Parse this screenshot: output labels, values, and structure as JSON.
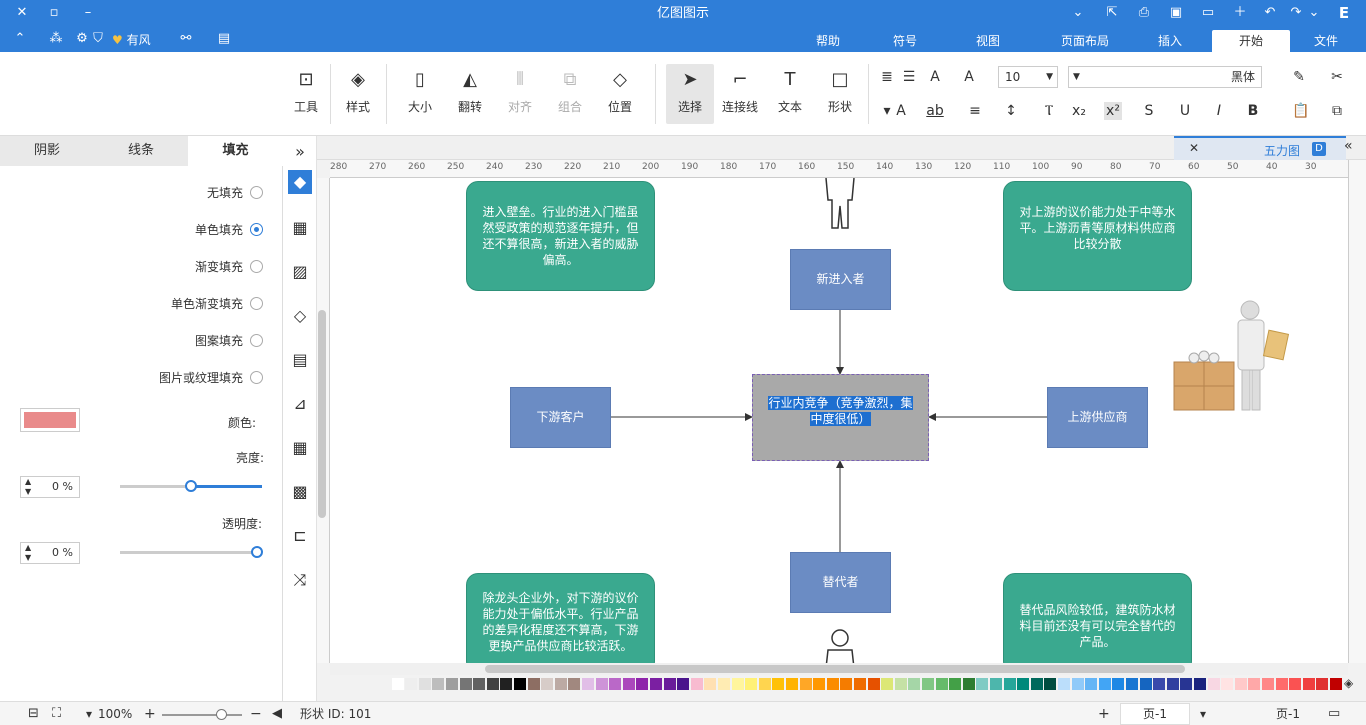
{
  "app": {
    "title": "亿图图示"
  },
  "menu": {
    "tabs": [
      "文件",
      "开始",
      "插入",
      "页面布局",
      "视图",
      "符号",
      "帮助"
    ],
    "active": "开始",
    "right_items": {
      "theme": "有风"
    }
  },
  "ribbon": {
    "font_name": "黑体",
    "font_size": "10",
    "buttons": {
      "shape": "形状",
      "text": "文本",
      "connector": "连接线",
      "select": "选择",
      "position": "位置",
      "group": "组合",
      "align": "对齐",
      "flip": "翻转",
      "size": "大小",
      "style": "样式",
      "tools": "工具"
    }
  },
  "left_panel": {
    "tabs": [
      "填充",
      "线条",
      "阴影"
    ],
    "active_tab": "填充",
    "fill_options": [
      "无填充",
      "单色填充",
      "渐变填充",
      "单色渐变填充",
      "图案填充",
      "图片或纹理填充"
    ],
    "selected_fill": "单色填充",
    "color_label": "颜色:",
    "color_value": "#e98a8a",
    "brightness_label": "亮度:",
    "brightness_value": "0 %",
    "transparency_label": "透明度:",
    "transparency_value": "0 %"
  },
  "doc_tab": {
    "name": "五力图"
  },
  "ruler": {
    "labels": [
      "280",
      "270",
      "260",
      "250",
      "240",
      "230",
      "220",
      "210",
      "200",
      "190",
      "180",
      "170",
      "160",
      "150",
      "140",
      "130",
      "120",
      "110",
      "100",
      "90",
      "80",
      "70",
      "60",
      "50",
      "40",
      "30"
    ]
  },
  "diagram": {
    "center": "行业内竞争（竞争激烈，集中度很低）",
    "top": "新进入者",
    "bottom": "替代者",
    "left": "下游客户",
    "right": "上游供应商",
    "top_left": "进入壁垒。行业的进入门槛虽然受政策的规范逐年提升，但还不算很高，新进入者的威胁偏高。",
    "top_right": "对上游的议价能力处于中等水平。上游沥青等原材料供应商比较分散",
    "bottom_left": "除龙头企业外，对下游的议价能力处于偏低水平。行业产品的差异化程度还不算高，下游更换产品供应商比较活跃。",
    "bottom_right": "替代品风险较低，建筑防水材料目前还没有可以完全替代的产品。"
  },
  "status": {
    "page_label": "页-1",
    "page_tab": "页-1",
    "shape_id": "形状 ID: 101",
    "zoom": "100%"
  },
  "palette": [
    "#c00000",
    "#e03131",
    "#f03e3e",
    "#fa5252",
    "#ff6b6b",
    "#ff8787",
    "#ffa8a8",
    "#ffc9c9",
    "#ffe3e3",
    "#f8d7e3",
    "#1a237e",
    "#283593",
    "#303f9f",
    "#3949ab",
    "#1565c0",
    "#1976d2",
    "#1e88e5",
    "#42a5f5",
    "#64b5f6",
    "#90caf9",
    "#bbdefb",
    "#004d40",
    "#00695c",
    "#00897b",
    "#26a69a",
    "#4db6ac",
    "#80cbc4",
    "#2e7d32",
    "#43a047",
    "#66bb6a",
    "#81c784",
    "#a5d6a7",
    "#c5e1a5",
    "#dce775",
    "#e65100",
    "#ef6c00",
    "#f57c00",
    "#fb8c00",
    "#ff9800",
    "#ffa726",
    "#ffb300",
    "#ffc107",
    "#ffd54f",
    "#fff176",
    "#fff59d",
    "#ffecb3",
    "#ffe0b2",
    "#f8bbd0",
    "#4a148c",
    "#6a1b9a",
    "#7b1fa2",
    "#8e24aa",
    "#ab47bc",
    "#ba68c8",
    "#ce93d8",
    "#e1bee7",
    "#a1887f",
    "#bcaaa4",
    "#d7ccc8",
    "#8d6e63",
    "#000000",
    "#212121",
    "#424242",
    "#616161",
    "#757575",
    "#9e9e9e",
    "#bdbdbd",
    "#e0e0e0",
    "#eeeeee",
    "#ffffff"
  ]
}
